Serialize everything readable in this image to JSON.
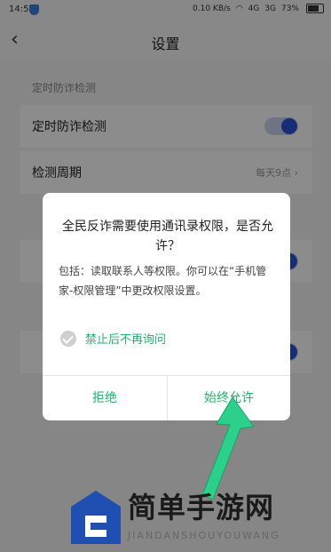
{
  "status_bar": {
    "time": "14:59",
    "net_speed": "0.10 KB/s",
    "signal_1": "4G",
    "signal_2": "3G",
    "battery": "73%"
  },
  "header": {
    "title": "设置"
  },
  "settings": {
    "section_1_label": "定时防诈检测",
    "row_timed_check": "定时防诈检测",
    "row_period_label": "检测周期",
    "row_period_value": "每天9点"
  },
  "dialog": {
    "title": "全民反诈需要使用通讯录权限，是否允许？",
    "body": "包括：读取联系人等权限。你可以在“手机管家-权限管理”中更改权限设置。",
    "checkbox_label": "禁止后不再询问",
    "deny_label": "拒绝",
    "allow_label": "始终允许"
  },
  "watermark": {
    "title": "简单手游网",
    "subtitle": "JIANDANSHOUYOUWANG"
  },
  "colors": {
    "accent_green": "#25b06d",
    "toggle_blue": "#2a55d8"
  }
}
